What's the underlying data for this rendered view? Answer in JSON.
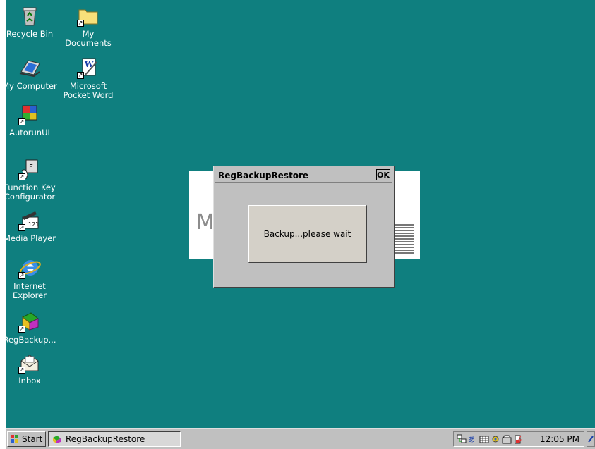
{
  "desktop": {
    "icons": [
      {
        "label": "Recycle Bin",
        "icon": "recycle-bin-icon"
      },
      {
        "label": "My\nDocuments",
        "icon": "folder-icon"
      },
      {
        "label": "My Computer",
        "icon": "computer-icon"
      },
      {
        "label": "Microsoft\nPocket Word",
        "icon": "word-document-icon"
      },
      {
        "label": "AutorunUI",
        "icon": "autorun-icon"
      },
      {
        "label": "Function Key\nConfigurator",
        "icon": "function-key-icon"
      },
      {
        "label": "Media Player",
        "icon": "media-player-icon"
      },
      {
        "label": "Internet\nExplorer",
        "icon": "internet-explorer-icon"
      },
      {
        "label": "RegBackup...",
        "icon": "regbackup-icon"
      },
      {
        "label": "Inbox",
        "icon": "inbox-icon"
      }
    ],
    "background_color": "#0f7f7f"
  },
  "dialog": {
    "title": "RegBackupRestore",
    "ok_label": "OK",
    "message": "Backup...please wait"
  },
  "taskbar": {
    "start_label": "Start",
    "task_label": "RegBackupRestore",
    "clock": "12:05 PM"
  }
}
